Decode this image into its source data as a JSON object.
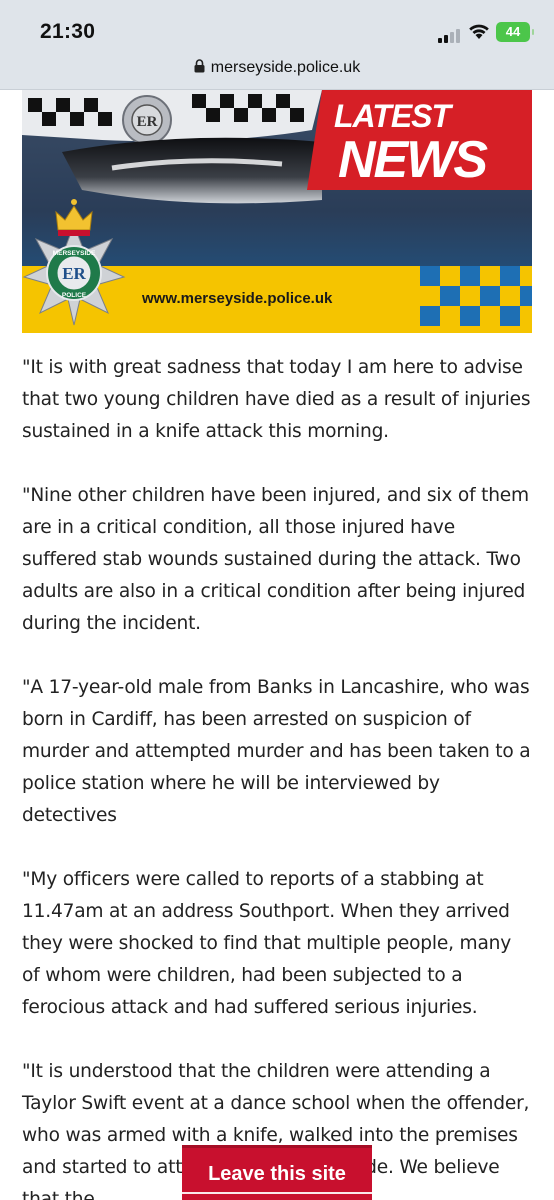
{
  "status_bar": {
    "time": "21:30",
    "battery": "44"
  },
  "browser": {
    "url": "merseyside.police.uk"
  },
  "banner": {
    "headline_line1": "LATEST",
    "headline_line2": "NEWS",
    "website": "www.merseyside.police.uk",
    "badge_top_text": "MERSEYSIDE",
    "badge_center_text": "ER",
    "badge_bottom_text": "POLICE",
    "colors": {
      "navy": "#1f3655",
      "red": "#d61f26",
      "yellow": "#f5c400",
      "blue": "#1e6fb4"
    }
  },
  "article": {
    "paragraphs": [
      "\"It is with great sadness that today I am here to advise that two young children have died as a result of injuries sustained in a knife attack this morning.",
      "\"Nine other children have been injured, and six of them are in a critical condition, all those injured have suffered stab wounds sustained during the attack. Two adults are also in a critical condition after being injured during the incident.",
      "\"A 17-year-old male from Banks in Lancashire, who was born in Cardiff, has been arrested on suspicion of murder and attempted murder and has been taken to a police station where he will be interviewed by detectives",
      "\"My officers were called to reports of a stabbing at 11.47am at an address Southport. When they arrived they were shocked to find that multiple people, many of whom were children, had been subjected to a ferocious attack and had suffered serious injuries.",
      "\"It is understood that the children were attending a Taylor Swift event at a dance school when the offender, who was armed with a knife, walked into the premises and started to attack the children inside.  We believe that the"
    ]
  },
  "leave_button": {
    "label": "Leave this site"
  }
}
